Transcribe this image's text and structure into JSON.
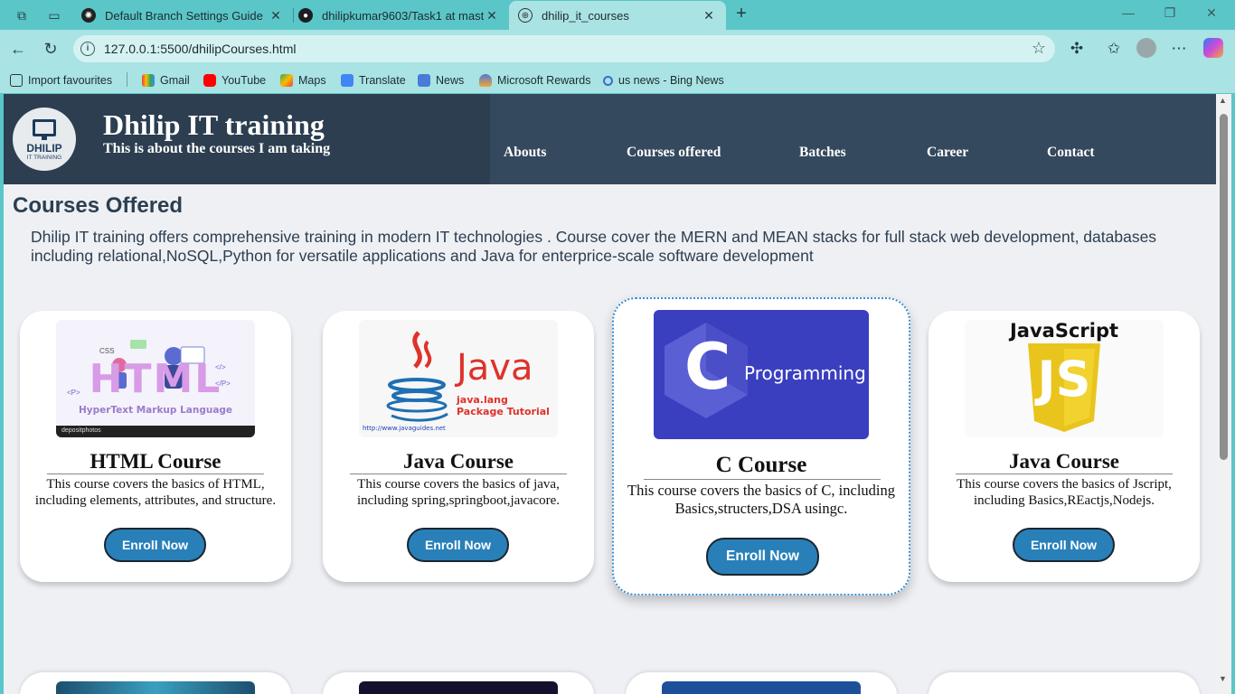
{
  "browser": {
    "tabs": [
      {
        "title": "Default Branch Settings Guide",
        "icon": "chatgpt-icon"
      },
      {
        "title": "dhilipkumar9603/Task1 at master",
        "icon": "github-icon"
      },
      {
        "title": "dhilip_it_courses",
        "icon": "globe-icon",
        "active": true
      }
    ],
    "address_url": "127.0.0.1:5500/dhilipCourses.html",
    "bookmarks": [
      {
        "label": "Import favourites",
        "icon": "import-icon"
      },
      {
        "label": "Gmail",
        "icon": "gmail-icon"
      },
      {
        "label": "YouTube",
        "icon": "youtube-icon"
      },
      {
        "label": "Maps",
        "icon": "maps-icon"
      },
      {
        "label": "Translate",
        "icon": "translate-icon"
      },
      {
        "label": "News",
        "icon": "news-icon"
      },
      {
        "label": "Microsoft Rewards",
        "icon": "rewards-icon"
      },
      {
        "label": "us news - Bing News",
        "icon": "bing-search-icon"
      }
    ]
  },
  "site": {
    "logo_line1": "DHILIP",
    "logo_line2": "IT TRAINING",
    "title": "Dhilip IT training",
    "subtitle": "This is about the courses I am taking",
    "menu": [
      "Abouts",
      "Courses offered",
      "Batches",
      "Career",
      "Contact"
    ]
  },
  "courses_section": {
    "title": "Courses Offered",
    "intro": "Dhilip IT training offers comprehensive training in modern IT technologies . Course cover the MERN and MEAN stacks for full stack web development, databases including relational,NoSQL,Python for versatile applications and Java for enterprice-scale software development",
    "cards": [
      {
        "title": "HTML Course",
        "desc": "This course covers the basics of HTML, including elements, attributes, and structure.",
        "button": "Enroll Now",
        "image": {
          "main": "HTML",
          "sub": "HyperText Markup Language",
          "tags": [
            "CSS",
            "<P>",
            "</P>",
            "</>"
          ],
          "credit": "depositphotos"
        }
      },
      {
        "title": "Java Course",
        "desc": "This course covers the basics of java, including spring,springboot,javacore.",
        "button": "Enroll Now",
        "image": {
          "main": "Java",
          "sub": "java.lang Package Tutorial",
          "site": "http://www.javaguides.net"
        }
      },
      {
        "title": "C Course",
        "desc": "This course covers the basics of C, including Basics,structers,DSA usingc.",
        "button": "Enroll Now",
        "image": {
          "letter": "C",
          "word": "Programming"
        }
      },
      {
        "title": "Java Course",
        "desc": "This course covers the basics of Jscript, including Basics,REactjs,Nodejs.",
        "button": "Enroll Now",
        "image": {
          "main": "JavaScript",
          "badge": "JS"
        }
      }
    ]
  },
  "colors": {
    "header_bg": "#2c3e50",
    "nav_bg": "#34495e",
    "button": "#2980b9",
    "page_bg": "#eef0f4",
    "browser_frame": "#5bc6c8"
  }
}
